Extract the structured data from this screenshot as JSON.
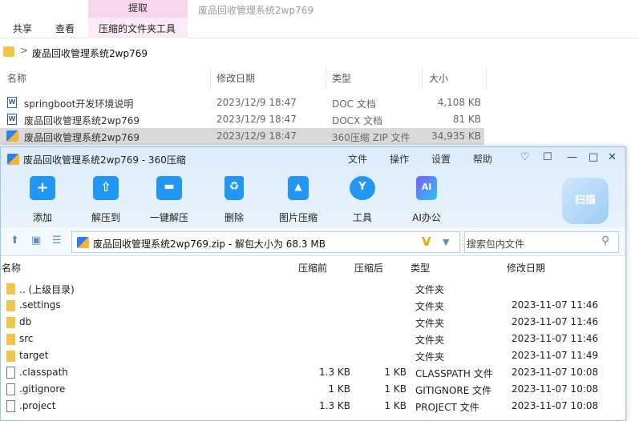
{
  "explorer": {
    "context_tab": "提取",
    "window_title": "废品回收管理系统2wp769",
    "ribbon_tabs": [
      "共享",
      "查看",
      "压缩的文件夹工具"
    ],
    "address_sep": ">",
    "address": "废品回收管理系统2wp769",
    "columns": {
      "name": "名称",
      "modified": "修改日期",
      "type": "类型",
      "size": "大小"
    },
    "files": [
      {
        "icon": "word-doc-icon",
        "name": "springboot开发环境说明",
        "modified": "2023/12/9 18:47",
        "type": "DOC 文档",
        "size": "4,108 KB"
      },
      {
        "icon": "word-doc-icon",
        "name": "废品回收管理系统2wp769",
        "modified": "2023/12/9 18:47",
        "type": "DOCX 文档",
        "size": "81 KB"
      },
      {
        "icon": "zip-archive-icon",
        "name": "废品回收管理系统2wp769",
        "modified": "2023/12/9 18:47",
        "type": "360压缩 ZIP 文件",
        "size": "34,935 KB"
      }
    ]
  },
  "zipwin": {
    "title": "废品回收管理系统2wp769 - 360压缩",
    "menu": [
      "文件",
      "操作",
      "设置",
      "帮助"
    ],
    "controls": [
      "♡",
      "☐",
      "—",
      "□",
      "✕"
    ],
    "toolbar": [
      {
        "label": "添加",
        "icon": "add-icon",
        "glyph": "+"
      },
      {
        "label": "解压到",
        "icon": "extract-to-icon",
        "glyph": "⇧"
      },
      {
        "label": "一键解压",
        "icon": "one-click-extract-icon",
        "glyph": "▬"
      },
      {
        "label": "删除",
        "icon": "delete-icon",
        "glyph": "♻"
      },
      {
        "label": "图片压缩",
        "icon": "image-compress-icon",
        "glyph": "▲"
      },
      {
        "label": "工具",
        "icon": "tools-icon",
        "glyph": "Y"
      },
      {
        "label": "AI办公",
        "icon": "ai-office-icon",
        "glyph": "AI"
      }
    ],
    "scan_label": "扫描",
    "path": "废品回收管理系统2wp769.zip - 解包大小为 68.3 MB",
    "v_mark": "V",
    "search_placeholder": "搜索包内文件",
    "columns": {
      "name": "名称",
      "compressed": "压缩前",
      "after": "压缩后",
      "type": "类型",
      "modified": "修改日期"
    },
    "rows": [
      {
        "kind": "folder",
        "name": ".. (上级目录)",
        "before": "",
        "after": "",
        "type": "文件夹",
        "modified": ""
      },
      {
        "kind": "folder",
        "name": ".settings",
        "before": "",
        "after": "",
        "type": "文件夹",
        "modified": "2023-11-07 11:46"
      },
      {
        "kind": "folder",
        "name": "db",
        "before": "",
        "after": "",
        "type": "文件夹",
        "modified": "2023-11-07 11:46"
      },
      {
        "kind": "folder",
        "name": "src",
        "before": "",
        "after": "",
        "type": "文件夹",
        "modified": "2023-11-07 11:46"
      },
      {
        "kind": "folder",
        "name": "target",
        "before": "",
        "after": "",
        "type": "文件夹",
        "modified": "2023-11-07 11:49"
      },
      {
        "kind": "file",
        "name": ".classpath",
        "before": "1.3 KB",
        "after": "1 KB",
        "type": "CLASSPATH 文件",
        "modified": "2023-11-07 10:08"
      },
      {
        "kind": "file",
        "name": ".gitignore",
        "before": "1 KB",
        "after": "1 KB",
        "type": "GITIGNORE 文件",
        "modified": "2023-11-07 10:08"
      },
      {
        "kind": "file",
        "name": ".project",
        "before": "1.3 KB",
        "after": "1 KB",
        "type": "PROJECT 文件",
        "modified": "2023-11-07 10:08"
      }
    ]
  }
}
